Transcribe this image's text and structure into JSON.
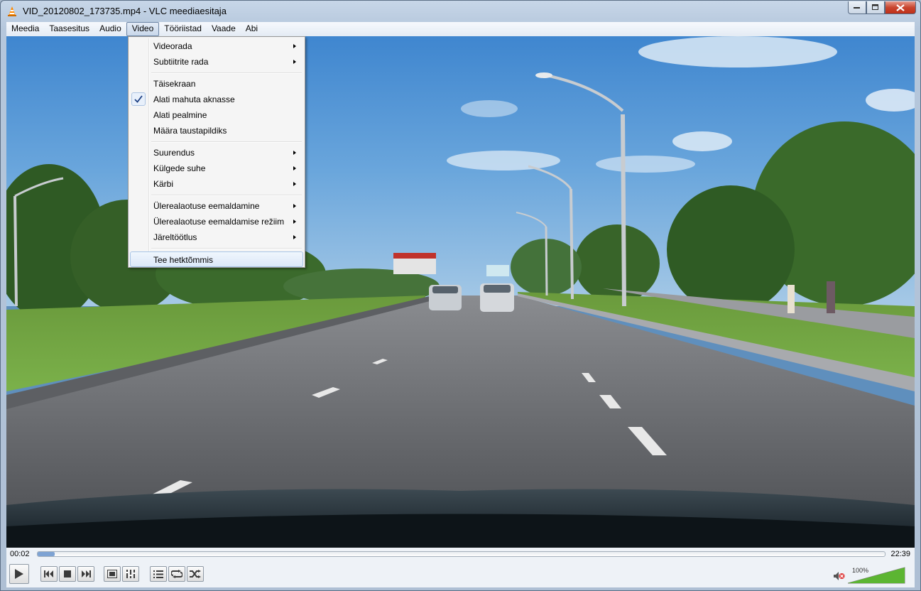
{
  "window": {
    "title": "VID_20120802_173735.mp4 - VLC meediaesitaja"
  },
  "menubar": {
    "items": [
      "Meedia",
      "Taasesitus",
      "Audio",
      "Video",
      "Tööriistad",
      "Vaade",
      "Abi"
    ],
    "active_item": "Video"
  },
  "video_menu": {
    "videorada": "Videorada",
    "subtiitrite_rada": "Subtiitrite rada",
    "taisekraan": "Täisekraan",
    "alati_mahuta_aknasse": "Alati mahuta aknasse",
    "alati_pealmine": "Alati pealmine",
    "maara_taustapildiks": "Määra taustapildiks",
    "suurendus": "Suurendus",
    "kulgede_suhe": "Külgede suhe",
    "karbi": "Kärbi",
    "ulerealaotuse_eemaldamine": "Ülerealaotuse eemaldamine",
    "ulerealaotuse_eemaldamise_reziim": "Ülerealaotuse eemaldamise režiim",
    "jareltootlus": "Järeltöötlus",
    "tee_hetktommis": "Tee hetktõmmis",
    "checked_item": "Alati mahuta aknasse",
    "highlighted_item": "Tee hetktõmmis"
  },
  "playback": {
    "elapsed": "00:02",
    "total": "22:39",
    "progress_fraction": 0.0015,
    "volume": "100%",
    "volume_fraction": 1.0
  },
  "icons": {
    "app": "vlc-cone-icon",
    "play": "play-icon",
    "previous": "previous-icon",
    "stop": "stop-icon",
    "next": "next-icon",
    "fullscreen": "fullscreen-icon",
    "extended_settings": "equalizer-icon",
    "playlist": "playlist-icon",
    "loop": "loop-icon",
    "shuffle": "shuffle-icon",
    "mute": "speaker-muted-icon"
  },
  "colors": {
    "accent": "#ff8800",
    "seek_fill": "#7ea3d3",
    "volume_fill": "#5cb532"
  }
}
